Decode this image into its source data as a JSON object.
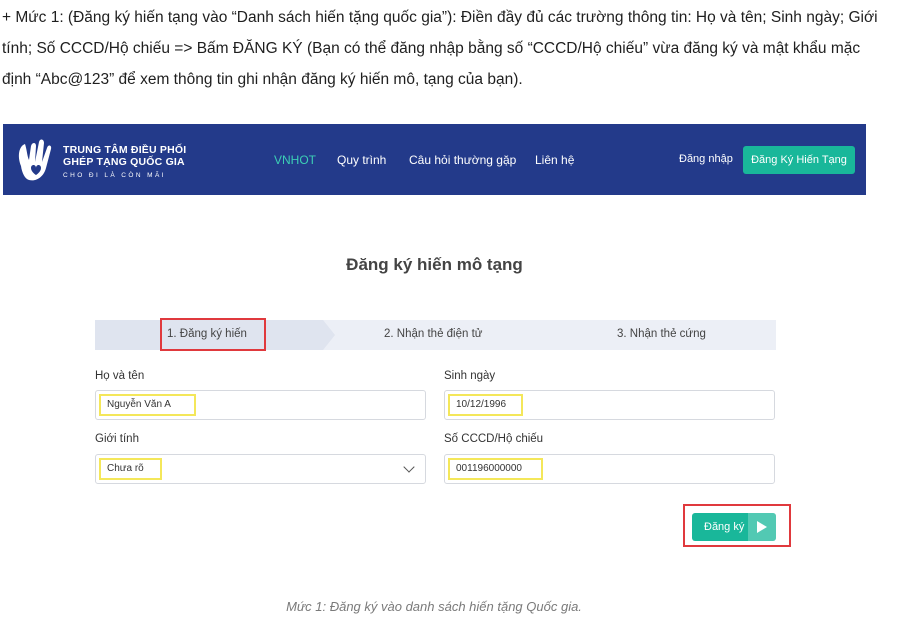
{
  "intro": {
    "text": "+ Mức 1: (Đăng ký hiến tạng vào “Danh sách hiến tặng quốc gia”): Điền đầy đủ các trường thông tin: Họ và tên; Sinh ngày; Giới tính; Số CCCD/Hộ chiếu => Bấm ĐĂNG KÝ  (Bạn có thể đăng nhập bằng số “CCCD/Hộ chiếu” vừa đăng ký và mật khẩu mặc định “Abc@123” để xem thông tin ghi nhận đăng ký hiến mô, tạng của bạn)."
  },
  "colors": {
    "nav_bg": "#233a8a",
    "accent": "#19b79a",
    "active_nav": "#3ccfb5",
    "highlight_red": "#e0393d",
    "highlight_yellow": "#f4e75a"
  },
  "header": {
    "logo_icon": "hands-heart-icon",
    "brand_line1": "TRUNG TÂM ĐIỀU PHỐI",
    "brand_line2": "GHÉP TẠNG QUỐC GIA",
    "brand_tagline": "CHO ĐI LÀ CÒN MÃI",
    "nav": [
      "VNHOT",
      "Quy trình",
      "Câu hỏi thường gặp",
      "Liên hệ"
    ],
    "active_nav_index": 0,
    "login": "Đăng nhập",
    "register": "Đăng Ký Hiến Tạng"
  },
  "form": {
    "title": "Đăng ký hiến mô tạng",
    "steps": [
      "1. Đăng ký hiến",
      "2. Nhận thẻ điện tử",
      "3. Nhận thẻ cứng"
    ],
    "active_step_index": 0,
    "fullname_label": "Họ và tên",
    "fullname_value": "Nguyễn Văn A",
    "dob_label": "Sinh ngày",
    "dob_value": "10/12/1996",
    "gender_label": "Giới tính",
    "gender_value": "Chưa rõ",
    "id_label": "Số CCCD/Hộ chiếu",
    "id_value": "001196000000",
    "submit_label": "Đăng ký",
    "submit_icon": "play-icon",
    "dropdown_icon": "chevron-down-icon"
  },
  "caption": "Mức 1: Đăng ký vào danh sách hiến tặng Quốc gia."
}
